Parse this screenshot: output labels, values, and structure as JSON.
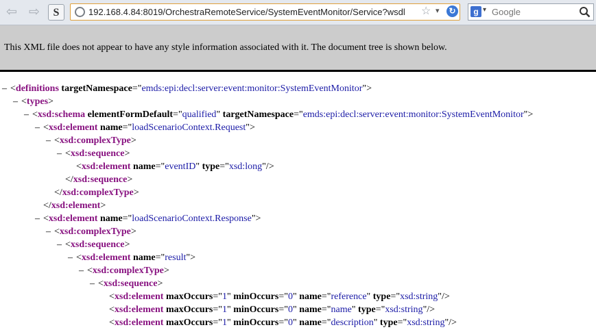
{
  "browser": {
    "url": "192.168.4.84:8019/OrchestraRemoteService/SystemEventMonitor/Service?wsdl",
    "search_placeholder": "Google",
    "s_button_label": "S",
    "search_engine_glyph": "g"
  },
  "banner": {
    "message": "This XML file does not appear to have any style information associated with it. The document tree is shown below."
  },
  "xml": {
    "definitions_tag": "definitions",
    "target_namespace_attr": "targetNamespace",
    "ns_value": "emds:epi:decl:server:event:monitor:SystemEventMonitor",
    "types_tag": "types",
    "schema_tag": "xsd:schema",
    "element_form_default_attr": "elementFormDefault",
    "qualified_value": "qualified",
    "element_tag": "xsd:element",
    "complex_type_tag": "xsd:complexType",
    "sequence_tag": "xsd:sequence",
    "name_attr": "name",
    "type_attr": "type",
    "max_occurs_attr": "maxOccurs",
    "min_occurs_attr": "minOccurs",
    "request_name": "loadScenarioContext.Request",
    "event_id_name": "eventID",
    "long_type": "xsd:long",
    "response_name": "loadScenarioContext.Response",
    "result_name": "result",
    "max_occurs_value": "1",
    "min_occurs_value": "0",
    "reference_name": "reference",
    "string_type": "xsd:string",
    "name_value": "name",
    "description_name": "description"
  }
}
